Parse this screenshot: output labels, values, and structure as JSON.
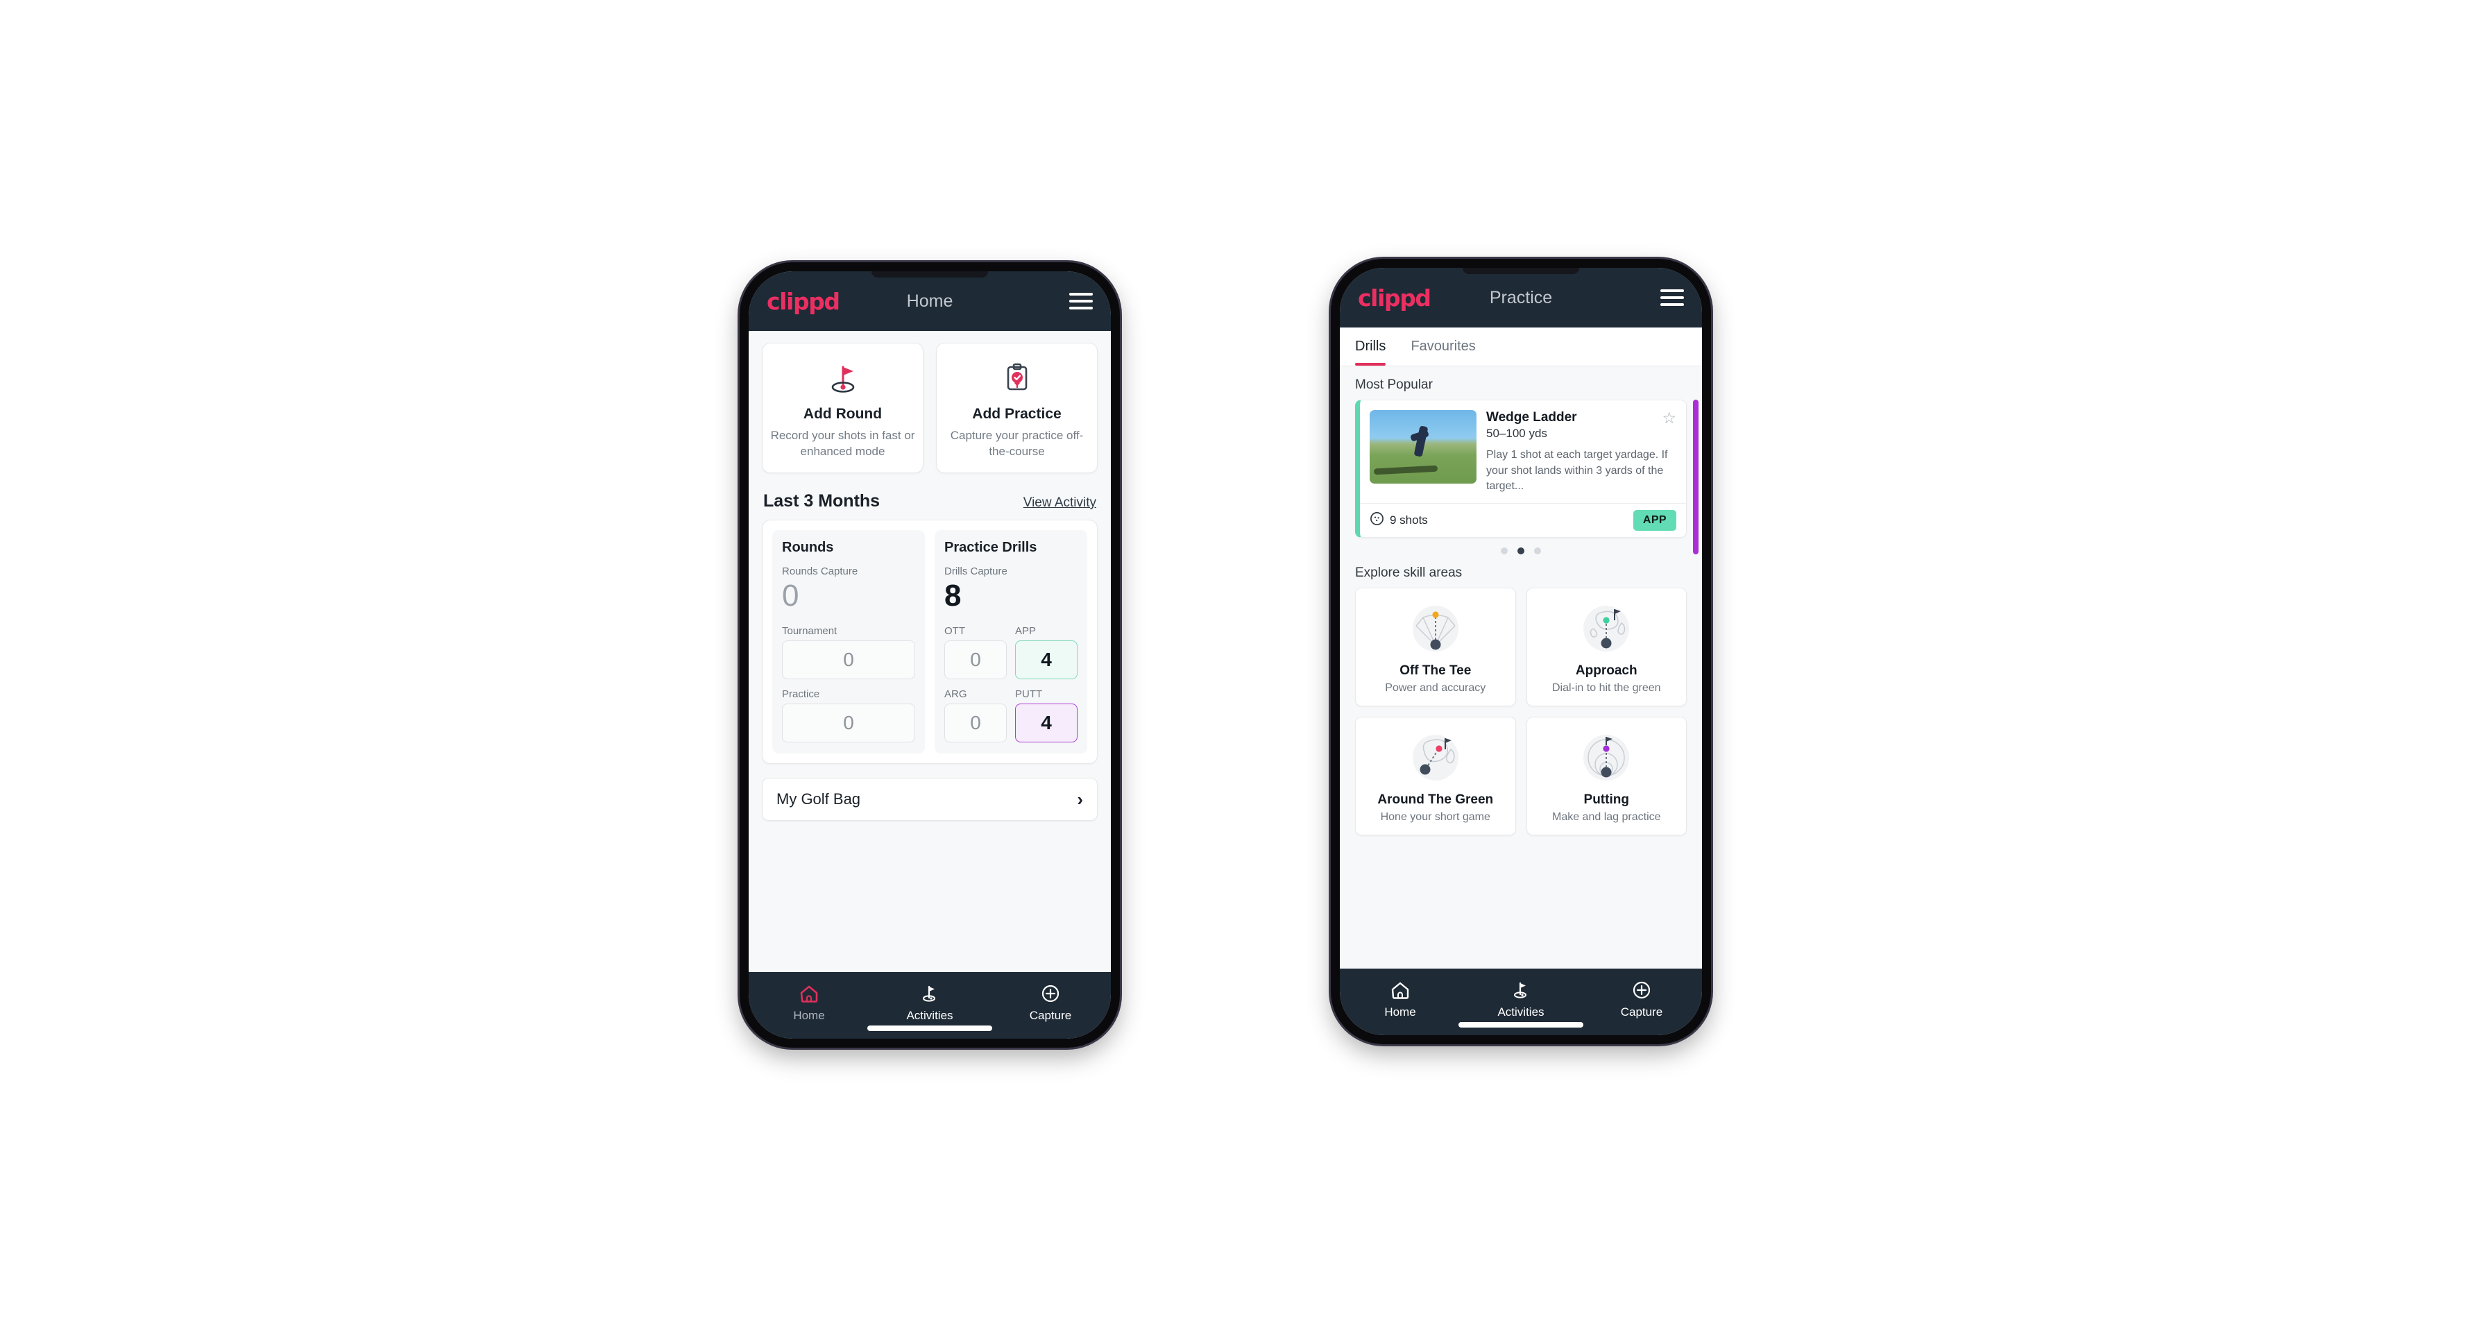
{
  "brand": {
    "logo_text": "clippd",
    "accent_pink": "#ec2f62",
    "dark_header": "#1e2a35"
  },
  "phone_home": {
    "appbar": {
      "title": "Home",
      "menu_icon": "hamburger-icon"
    },
    "actions": [
      {
        "icon": "golf-flag-icon",
        "title": "Add Round",
        "subtitle": "Record your shots in fast or enhanced mode"
      },
      {
        "icon": "clipboard-check-icon",
        "title": "Add Practice",
        "subtitle": "Capture your practice off-the-course"
      }
    ],
    "section": {
      "title": "Last 3 Months",
      "link": "View Activity"
    },
    "rounds": {
      "heading": "Rounds",
      "capture_label": "Rounds Capture",
      "capture_value": "0",
      "fields": [
        {
          "label": "Tournament",
          "value": "0",
          "state": "empty"
        },
        {
          "label": "Practice",
          "value": "0",
          "state": "empty"
        }
      ]
    },
    "drills": {
      "heading": "Practice Drills",
      "capture_label": "Drills Capture",
      "capture_value": "8",
      "fields": [
        {
          "label": "OTT",
          "value": "0",
          "state": "empty"
        },
        {
          "label": "APP",
          "value": "4",
          "state": "green"
        },
        {
          "label": "ARG",
          "value": "0",
          "state": "empty"
        },
        {
          "label": "PUTT",
          "value": "4",
          "state": "purple"
        }
      ]
    },
    "golf_bag": {
      "label": "My Golf Bag",
      "chevron": "chevron-right-icon"
    },
    "bottom_nav": [
      {
        "label": "Home",
        "icon": "home-icon",
        "active": true
      },
      {
        "label": "Activities",
        "icon": "golf-flag-icon",
        "active": false
      },
      {
        "label": "Capture",
        "icon": "plus-circle-icon",
        "active": false
      }
    ]
  },
  "phone_practice": {
    "appbar": {
      "title": "Practice",
      "menu_icon": "hamburger-icon"
    },
    "tabs": [
      {
        "label": "Drills",
        "active": true
      },
      {
        "label": "Favourites",
        "active": false
      }
    ],
    "most_popular_label": "Most Popular",
    "drill": {
      "title": "Wedge Ladder",
      "yardage": "50–100 yds",
      "description": "Play 1 shot at each target yardage. If your shot lands within 3 yards of the target...",
      "shots": "9 shots",
      "shots_icon": "golf-ball-icon",
      "badge": "APP",
      "badge_color": "#62dcb4",
      "star_icon": "star-outline-icon",
      "accent_color": "#5fd8b2",
      "next_accent_color": "#aa2fd6"
    },
    "carousel_dots": {
      "count": 3,
      "active_index": 1
    },
    "skills_label": "Explore skill areas",
    "skills": [
      {
        "title": "Off The Tee",
        "subtitle": "Power and accuracy",
        "icon": "tee-fan-icon",
        "dot_color": "#f2a81e"
      },
      {
        "title": "Approach",
        "subtitle": "Dial-in to hit the green",
        "icon": "green-approach-icon",
        "dot_color": "#3fcfa1"
      },
      {
        "title": "Around The Green",
        "subtitle": "Hone your short game",
        "icon": "chip-green-icon",
        "dot_color": "#ec3f68"
      },
      {
        "title": "Putting",
        "subtitle": "Make and lag practice",
        "icon": "putting-rings-icon",
        "dot_color": "#a12fd6"
      }
    ],
    "bottom_nav": [
      {
        "label": "Home",
        "icon": "home-icon",
        "active": false
      },
      {
        "label": "Activities",
        "icon": "golf-flag-icon",
        "active": true
      },
      {
        "label": "Capture",
        "icon": "plus-circle-icon",
        "active": false
      }
    ]
  }
}
